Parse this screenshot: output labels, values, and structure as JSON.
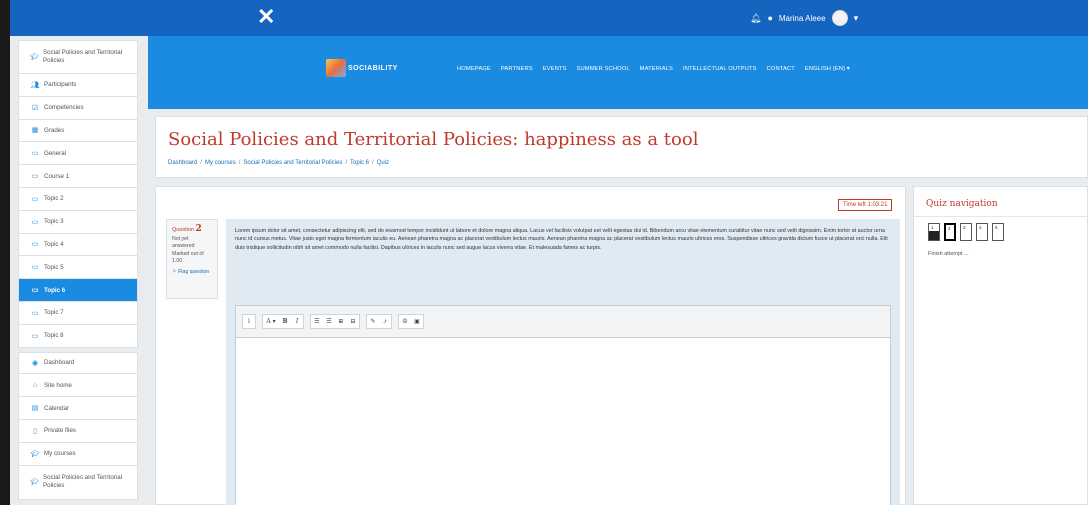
{
  "topbar": {
    "close_glyph": "✕",
    "user_name": "Marina Aleee",
    "icons": [
      "bell-icon",
      "chat-icon",
      "caret-down-icon"
    ]
  },
  "sidebar": {
    "items": [
      {
        "label": "Social Policies and Territorial Policies",
        "icon": "graduation-cap-icon"
      },
      {
        "label": "Participants",
        "icon": "users-icon"
      },
      {
        "label": "Competencies",
        "icon": "check-badge-icon"
      },
      {
        "label": "Grades",
        "icon": "grid-icon"
      },
      {
        "label": "General",
        "icon": "folder-icon"
      },
      {
        "label": "Course 1",
        "icon": "folder-icon"
      },
      {
        "label": "Topic 2",
        "icon": "folder-icon"
      },
      {
        "label": "Topic 3",
        "icon": "folder-icon"
      },
      {
        "label": "Topic 4",
        "icon": "folder-icon"
      },
      {
        "label": "Topic 5",
        "icon": "folder-icon"
      },
      {
        "label": "Topic 6",
        "icon": "folder-icon"
      },
      {
        "label": "Topic 7",
        "icon": "folder-icon"
      },
      {
        "label": "Topic 8",
        "icon": "folder-icon"
      }
    ],
    "items2": [
      {
        "label": "Dashboard",
        "icon": "dashboard-icon"
      },
      {
        "label": "Site home",
        "icon": "home-icon"
      },
      {
        "label": "Calendar",
        "icon": "calendar-icon"
      },
      {
        "label": "Private files",
        "icon": "file-icon"
      },
      {
        "label": "My courses",
        "icon": "graduation-cap-icon"
      },
      {
        "label": "Social Policies and Territorial Policies",
        "icon": "graduation-cap-icon"
      }
    ]
  },
  "banner": {
    "logo_text": "SOCIABILITY",
    "nav": [
      "HOMEPAGE",
      "PARTNERS",
      "EVENTS",
      "SUMMER SCHOOL",
      "MATERIALS",
      "INTELLECTUAL OUTPUTS",
      "CONTACT",
      "ENGLISH (EN) ▾"
    ]
  },
  "page": {
    "title": "Social Policies and Territorial Policies: happiness as a tool",
    "breadcrumb": [
      "Dashboard",
      "My courses",
      "Social Policies and Territorial Policies",
      "Topic 6",
      "Quiz"
    ]
  },
  "quiz": {
    "timer": "Time left 1:03:21",
    "question_label": "Question",
    "question_number": "2",
    "status": "Not yet answered",
    "marked": "Marked out of 1.00",
    "flag": "Flag question",
    "text": "Lorem ipsum dolor sit amet, consectetur adipiscing elit, sed do eiusmod tempor incididunt ut labore et dolore magna aliqua. Lacus vel facilisis volutpat est velit egestas dui id. Bibendum arcu vitae elementum curabitur vitae nunc sed velit dignissim. Enim tortor at auctor urna nunc id cursus metus. Vitae justo eget magna fermentum iaculis eu. Aenean pharetra magna ac placerat vestibulum lectus mauris. Aenean pharetra magna ac placerat vestibulum lectus mauris ultrices eros. Suspendisse ultrices gravida dictum fusce ut placerat orci nulla. Elit duis tristique sollicitudin nibh sit amet commodo nulla facilisi. Dapibus ultrices in iaculis nunc sed augue lacus viverra vitae. Et malesuada fames ac turpis.",
    "toolbar": [
      "i",
      "A ▾",
      "B",
      "I",
      "☰",
      "☰",
      "⊞",
      "⊟",
      "✎",
      "⤴",
      "☺",
      "▣"
    ]
  },
  "quiz_nav": {
    "title": "Quiz navigation",
    "buttons": [
      "1",
      "2",
      "3",
      "4",
      "5"
    ],
    "finish": "Finish attempt ..."
  }
}
